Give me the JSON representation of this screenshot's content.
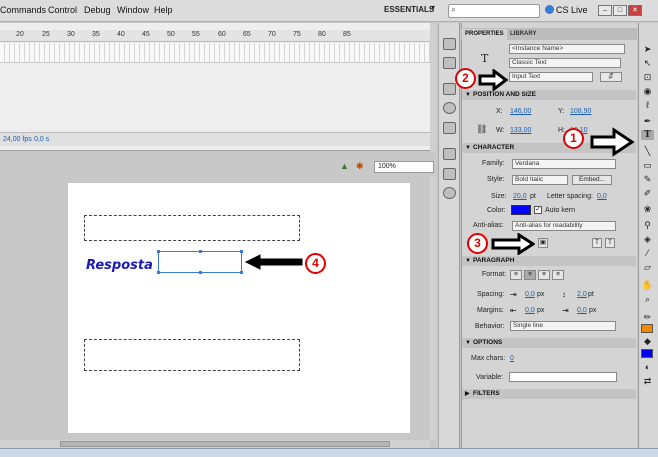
{
  "menu": [
    "Commands",
    "Control",
    "Debug",
    "Window",
    "Help"
  ],
  "workspace": "ESSENTIALS",
  "search": {
    "placeholder": ""
  },
  "cslive": "CS Live",
  "timeline": {
    "ruler": [
      "20",
      "25",
      "30",
      "35",
      "40",
      "45",
      "50",
      "55",
      "60",
      "65",
      "70",
      "75",
      "80",
      "85"
    ],
    "fps": "24,00 fps",
    "time": "0,0 s"
  },
  "stage": {
    "zoom": "100%",
    "label": "Resposta"
  },
  "properties": {
    "tabs": [
      "PROPERTIES",
      "LIBRARY"
    ],
    "instance_name": "<Instance Name>",
    "text_engine": "Classic Text",
    "text_type": "Input Text",
    "position_size": {
      "title": "POSITION AND SIZE",
      "x_label": "X:",
      "x": "146,00",
      "y_label": "Y:",
      "y": "108,90",
      "w_label": "W:",
      "w": "133,00",
      "h_label": "H:",
      "h": "18,10"
    },
    "character": {
      "title": "CHARACTER",
      "family_label": "Family:",
      "family": "Verdana",
      "style_label": "Style:",
      "style": "Bold Italic",
      "embed": "Embed...",
      "size_label": "Size:",
      "size": "20,0",
      "size_unit": "pt",
      "spacing_label": "Letter spacing:",
      "spacing": "0,0",
      "color_label": "Color:",
      "color": "#0000ff",
      "autokern": "Auto kern",
      "antialias_label": "Anti-alias:",
      "antialias": "Anti-alias for readability"
    },
    "paragraph": {
      "title": "PARAGRAPH",
      "format_label": "Format:",
      "spacing_label": "Spacing:",
      "spacing1": "0,0",
      "spacing1_unit": "px",
      "spacing2": "2,0",
      "spacing2_unit": "pt",
      "margins_label": "Margins:",
      "margin1": "0,0",
      "margin1_unit": "px",
      "margin2": "0,0",
      "margin2_unit": "px",
      "behavior_label": "Behavior:",
      "behavior": "Single line"
    },
    "options": {
      "title": "OPTIONS",
      "maxchars_label": "Max chars:",
      "maxchars": "0",
      "variable_label": "Variable:"
    },
    "filters": {
      "title": "FILTERS"
    }
  },
  "annotations": [
    "1",
    "2",
    "3",
    "4"
  ],
  "colors": {
    "annotation": "#e00000",
    "text_color": "#0000ff",
    "stage_text": "#1a1ab8"
  }
}
